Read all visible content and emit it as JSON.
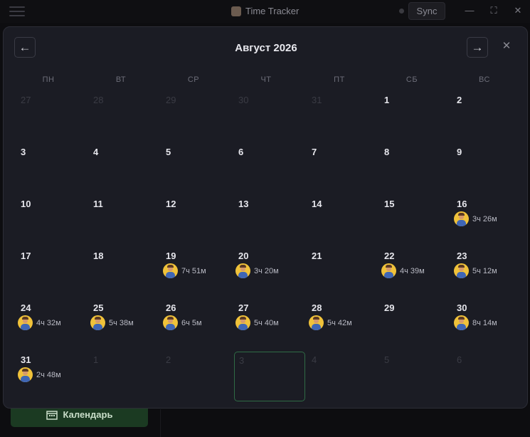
{
  "app": {
    "title": "Time Tracker",
    "sync_label": "Sync",
    "icon": "app-logo-icon"
  },
  "window_controls": {
    "minimize": "—",
    "maximize": "⛶",
    "close": "✕"
  },
  "background": {
    "calendar_button_label": "Календарь"
  },
  "modal": {
    "month_title": "Август 2026",
    "prev_label": "←",
    "next_label": "→",
    "close_label": "✕",
    "weekdays": [
      "ПН",
      "ВТ",
      "СР",
      "ЧТ",
      "ПТ",
      "СБ",
      "ВС"
    ],
    "days": [
      {
        "day": "27",
        "out": true
      },
      {
        "day": "28",
        "out": true
      },
      {
        "day": "29",
        "out": true
      },
      {
        "day": "30",
        "out": true
      },
      {
        "day": "31",
        "out": true
      },
      {
        "day": "1"
      },
      {
        "day": "2"
      },
      {
        "day": "3"
      },
      {
        "day": "4"
      },
      {
        "day": "5"
      },
      {
        "day": "6"
      },
      {
        "day": "7"
      },
      {
        "day": "8"
      },
      {
        "day": "9"
      },
      {
        "day": "10"
      },
      {
        "day": "11"
      },
      {
        "day": "12"
      },
      {
        "day": "13"
      },
      {
        "day": "14"
      },
      {
        "day": "15"
      },
      {
        "day": "16",
        "entry": "3ч 26м"
      },
      {
        "day": "17"
      },
      {
        "day": "18"
      },
      {
        "day": "19",
        "entry": "7ч 51м"
      },
      {
        "day": "20",
        "entry": "3ч 20м"
      },
      {
        "day": "21"
      },
      {
        "day": "22",
        "entry": "4ч 39м"
      },
      {
        "day": "23",
        "entry": "5ч 12м"
      },
      {
        "day": "24",
        "entry": "4ч 32м"
      },
      {
        "day": "25",
        "entry": "5ч 38м"
      },
      {
        "day": "26",
        "entry": "6ч 5м"
      },
      {
        "day": "27",
        "entry": "5ч 40м"
      },
      {
        "day": "28",
        "entry": "5ч 42м"
      },
      {
        "day": "29"
      },
      {
        "day": "30",
        "entry": "8ч 14м"
      },
      {
        "day": "31",
        "entry": "2ч 48м"
      },
      {
        "day": "1",
        "out": true
      },
      {
        "day": "2",
        "out": true
      },
      {
        "day": "3",
        "out": true,
        "today": true
      },
      {
        "day": "4",
        "out": true
      },
      {
        "day": "5",
        "out": true
      },
      {
        "day": "6",
        "out": true
      }
    ]
  },
  "colors": {
    "accent_green": "#2f6b45",
    "avatar_bg": "#f0c23a"
  }
}
